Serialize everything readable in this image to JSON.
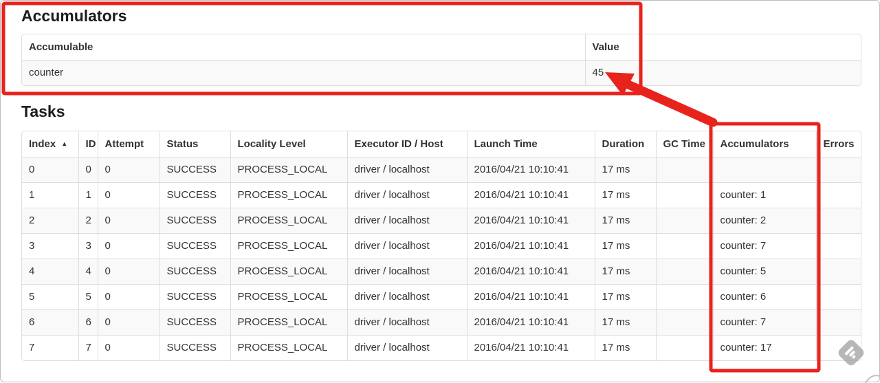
{
  "accumulators_section": {
    "title": "Accumulators",
    "table": {
      "headers": [
        "Accumulable",
        "Value"
      ],
      "rows": [
        {
          "accumulable": "counter",
          "value": "45"
        }
      ]
    }
  },
  "tasks_section": {
    "title": "Tasks",
    "table": {
      "headers": [
        "Index",
        "ID",
        "Attempt",
        "Status",
        "Locality Level",
        "Executor ID / Host",
        "Launch Time",
        "Duration",
        "GC Time",
        "Accumulators",
        "Errors"
      ],
      "sort_icon": "▲",
      "rows": [
        {
          "index": "0",
          "id": "0",
          "attempt": "0",
          "status": "SUCCESS",
          "locality": "PROCESS_LOCAL",
          "executor": "driver / localhost",
          "launch": "2016/04/21 10:10:41",
          "duration": "17 ms",
          "gc": "",
          "accumulators": "",
          "errors": ""
        },
        {
          "index": "1",
          "id": "1",
          "attempt": "0",
          "status": "SUCCESS",
          "locality": "PROCESS_LOCAL",
          "executor": "driver / localhost",
          "launch": "2016/04/21 10:10:41",
          "duration": "17 ms",
          "gc": "",
          "accumulators": "counter: 1",
          "errors": ""
        },
        {
          "index": "2",
          "id": "2",
          "attempt": "0",
          "status": "SUCCESS",
          "locality": "PROCESS_LOCAL",
          "executor": "driver / localhost",
          "launch": "2016/04/21 10:10:41",
          "duration": "17 ms",
          "gc": "",
          "accumulators": "counter: 2",
          "errors": ""
        },
        {
          "index": "3",
          "id": "3",
          "attempt": "0",
          "status": "SUCCESS",
          "locality": "PROCESS_LOCAL",
          "executor": "driver / localhost",
          "launch": "2016/04/21 10:10:41",
          "duration": "17 ms",
          "gc": "",
          "accumulators": "counter: 7",
          "errors": ""
        },
        {
          "index": "4",
          "id": "4",
          "attempt": "0",
          "status": "SUCCESS",
          "locality": "PROCESS_LOCAL",
          "executor": "driver / localhost",
          "launch": "2016/04/21 10:10:41",
          "duration": "17 ms",
          "gc": "",
          "accumulators": "counter: 5",
          "errors": ""
        },
        {
          "index": "5",
          "id": "5",
          "attempt": "0",
          "status": "SUCCESS",
          "locality": "PROCESS_LOCAL",
          "executor": "driver / localhost",
          "launch": "2016/04/21 10:10:41",
          "duration": "17 ms",
          "gc": "",
          "accumulators": "counter: 6",
          "errors": ""
        },
        {
          "index": "6",
          "id": "6",
          "attempt": "0",
          "status": "SUCCESS",
          "locality": "PROCESS_LOCAL",
          "executor": "driver / localhost",
          "launch": "2016/04/21 10:10:41",
          "duration": "17 ms",
          "gc": "",
          "accumulators": "counter: 7",
          "errors": ""
        },
        {
          "index": "7",
          "id": "7",
          "attempt": "0",
          "status": "SUCCESS",
          "locality": "PROCESS_LOCAL",
          "executor": "driver / localhost",
          "launch": "2016/04/21 10:10:41",
          "duration": "17 ms",
          "gc": "",
          "accumulators": "counter: 17",
          "errors": ""
        }
      ]
    }
  },
  "annotations": {
    "color": "#e8231c"
  }
}
